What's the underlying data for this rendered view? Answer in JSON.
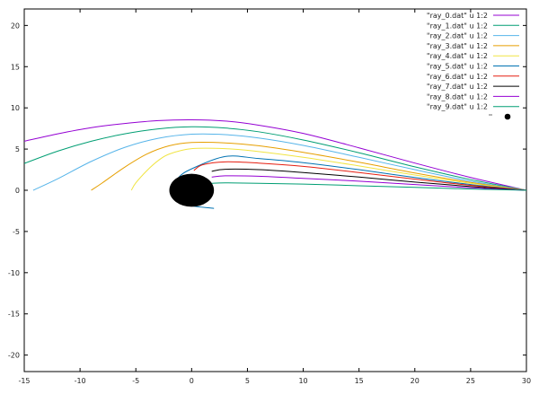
{
  "chart_data": {
    "type": "line",
    "title": "",
    "xlabel": "",
    "ylabel": "",
    "xlim": [
      -15,
      30
    ],
    "ylim": [
      -22,
      22
    ],
    "xticks": [
      "-15",
      "-10",
      "-5",
      "0",
      "5",
      "10",
      "15",
      "20",
      "25",
      "30"
    ],
    "yticks": [
      "-20",
      "-15",
      "-10",
      "-5",
      "0",
      "5",
      "10",
      "15",
      "20"
    ],
    "grid": false,
    "legend_position": "top-right",
    "series": [
      {
        "name": "\"ray_0.dat\" u 1:2",
        "color": "#9400d3",
        "x": [
          -15,
          -12,
          -9,
          -6,
          -3,
          0,
          3,
          6,
          10,
          15,
          20,
          25,
          30
        ],
        "y": [
          5.95,
          6.85,
          7.6,
          8.1,
          8.45,
          8.55,
          8.4,
          7.9,
          6.9,
          5.15,
          3.3,
          1.55,
          0
        ]
      },
      {
        "name": "\"ray_1.dat\" u 1:2",
        "color": "#009e73",
        "x": [
          -15,
          -12,
          -9,
          -6,
          -3,
          0,
          3,
          6,
          10,
          15,
          20,
          25,
          30
        ],
        "y": [
          3.25,
          4.75,
          5.95,
          6.85,
          7.45,
          7.7,
          7.55,
          7.1,
          6.1,
          4.55,
          2.85,
          1.3,
          0
        ]
      },
      {
        "name": "\"ray_2.dat\" u 1:2",
        "color": "#56b4e9",
        "x": [
          -14.2,
          -12,
          -9,
          -6,
          -3,
          0,
          3,
          6,
          10,
          15,
          20,
          25,
          30
        ],
        "y": [
          0,
          1.4,
          3.5,
          5.2,
          6.3,
          6.8,
          6.75,
          6.35,
          5.45,
          4.0,
          2.5,
          1.1,
          0
        ]
      },
      {
        "name": "\"ray_3.dat\" u 1:2",
        "color": "#e69f00",
        "x": [
          -9,
          -8,
          -6,
          -4,
          -2,
          0,
          3,
          6,
          10,
          15,
          20,
          25,
          30
        ],
        "y": [
          0,
          0.9,
          2.8,
          4.4,
          5.4,
          5.8,
          5.75,
          5.4,
          4.6,
          3.4,
          2.1,
          0.95,
          0
        ]
      },
      {
        "name": "\"ray_4.dat\" u 1:2",
        "color": "#f0e442",
        "x": [
          -5.4,
          -5,
          -4,
          -3,
          -2,
          0,
          3,
          6,
          10,
          15,
          20,
          25,
          30
        ],
        "y": [
          0,
          0.9,
          2.4,
          3.6,
          4.4,
          5.05,
          5.05,
          4.7,
          4.0,
          2.95,
          1.85,
          0.85,
          0
        ]
      },
      {
        "name": "\"ray_5.dat\" u 1:2",
        "color": "#0072b2",
        "x": [
          2.0,
          -1,
          -1.6,
          -1.2,
          0,
          3,
          6,
          10,
          15,
          20,
          25,
          30
        ],
        "y": [
          -2.2,
          -1.6,
          0,
          1.5,
          2.6,
          4.1,
          3.85,
          3.35,
          2.5,
          1.55,
          0.7,
          0
        ]
      },
      {
        "name": "\"ray_6.dat\" u 1:2",
        "color": "#e51e10",
        "x": [
          0.2,
          1,
          3,
          6,
          10,
          15,
          20,
          25,
          30
        ],
        "y": [
          2.4,
          3.1,
          3.45,
          3.3,
          2.9,
          2.15,
          1.35,
          0.6,
          0
        ]
      },
      {
        "name": "\"ray_7.dat\" u 1:2",
        "color": "#000000",
        "x": [
          1.8,
          3,
          6,
          10,
          15,
          20,
          25,
          30
        ],
        "y": [
          2.3,
          2.55,
          2.5,
          2.15,
          1.6,
          1.0,
          0.45,
          0
        ]
      },
      {
        "name": "\"ray_8.dat\" u 1:2",
        "color": "#9400d3",
        "x": [
          1.8,
          3,
          6,
          10,
          15,
          20,
          25,
          30
        ],
        "y": [
          1.6,
          1.75,
          1.7,
          1.45,
          1.1,
          0.7,
          0.3,
          0
        ]
      },
      {
        "name": "\"ray_9.dat\" u 1:2",
        "color": "#009e73",
        "x": [
          1.8,
          3,
          6,
          10,
          15,
          20,
          25,
          30
        ],
        "y": [
          0.85,
          0.9,
          0.85,
          0.75,
          0.55,
          0.35,
          0.15,
          0
        ]
      }
    ],
    "black_hole": {
      "x": 0,
      "y": 0,
      "radius": 2.0,
      "color": "#000000"
    },
    "legend_extra_marker": {
      "color": "#000000"
    }
  }
}
